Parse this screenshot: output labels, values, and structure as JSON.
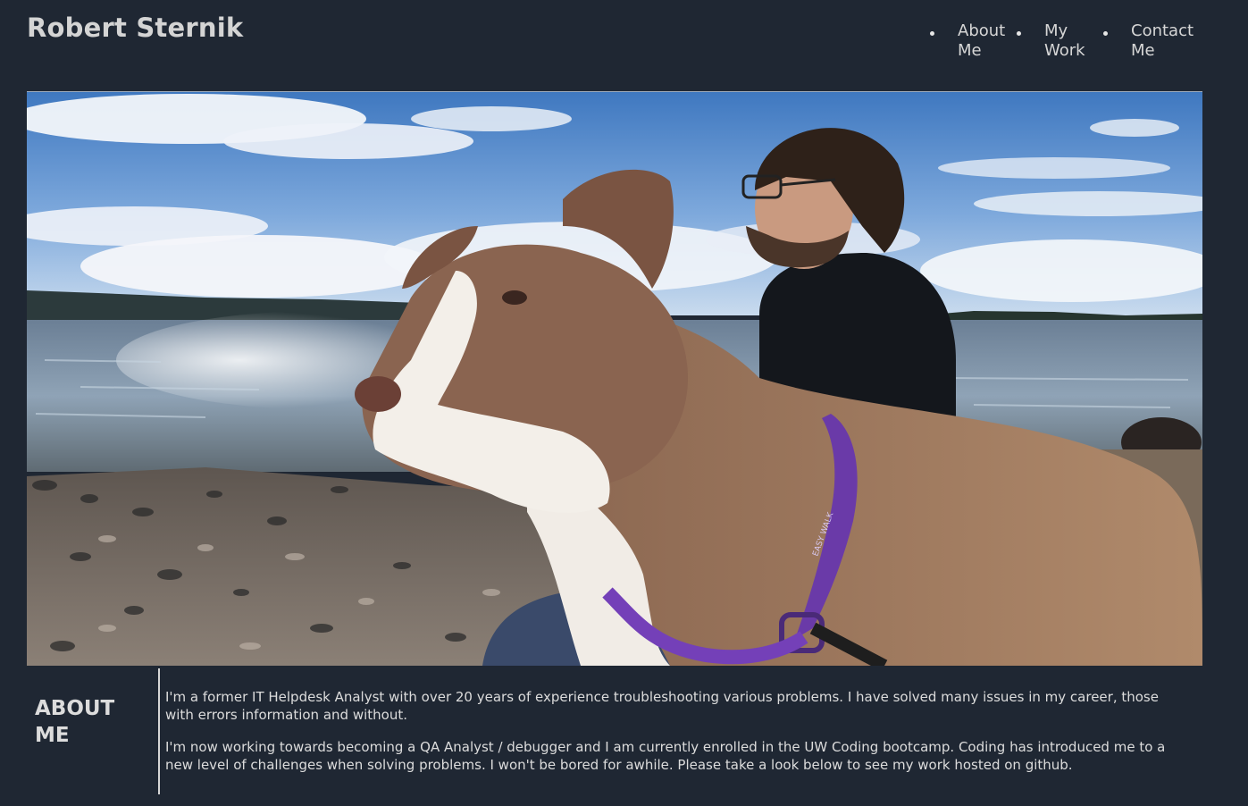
{
  "site": {
    "title": "Robert Sternik"
  },
  "nav": {
    "items": [
      {
        "label": "About Me"
      },
      {
        "label": "My Work"
      },
      {
        "label": "Contact Me"
      }
    ]
  },
  "hero": {
    "image_icon": "photo-of-man-and-dog-at-beach",
    "collar_text": "EASY WALK"
  },
  "about": {
    "heading": "About Me",
    "paragraphs": [
      "I'm a former IT Helpdesk Analyst with over 20 years of experience troubleshooting various problems. I have solved many issues in my career, those with errors information and without.",
      "I'm now working towards becoming a QA Analyst / debugger and I am currently enrolled in the UW Coding bootcamp. Coding has introduced me to a new level of challenges when solving problems. I won't be bored for awhile. Please take a look below to see my work hosted on github."
    ]
  },
  "colors": {
    "background": "#1f2733",
    "text": "#dcdcdc",
    "divider": "#d6d6d6"
  }
}
